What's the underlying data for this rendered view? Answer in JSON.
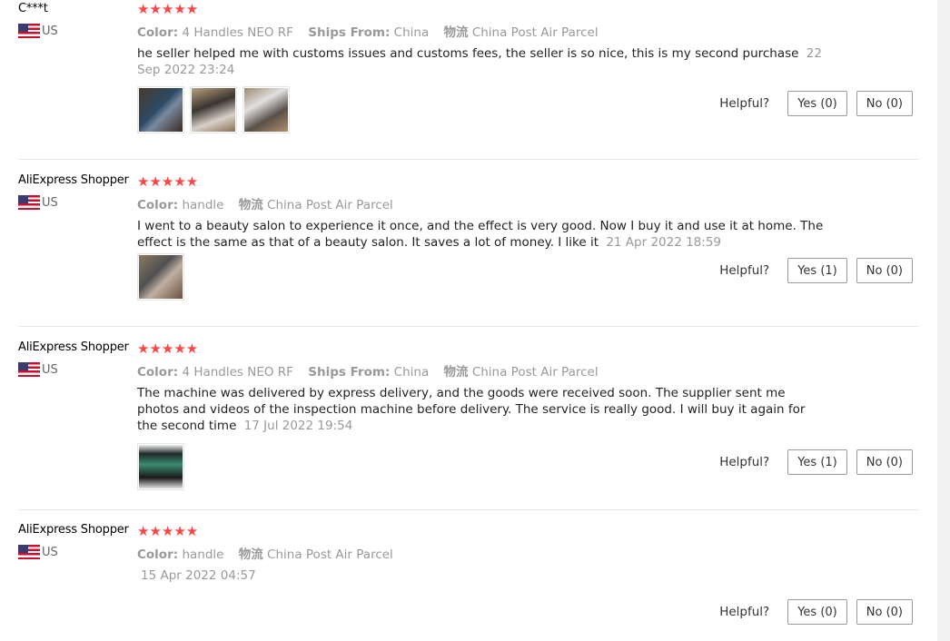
{
  "reviews": [
    {
      "user": "C***t",
      "country": "US",
      "rating": 5,
      "meta": [
        {
          "label": "Color:",
          "value": "4 Handles NEO RF"
        },
        {
          "label": "Ships From:",
          "value": "China"
        },
        {
          "label": "物流",
          "value": "China Post Air Parcel"
        }
      ],
      "text": "he seller helped me with customs issues and customs fees, the seller is so nice, this is my second purchase",
      "date": "22 Sep 2022 23:24",
      "photos": [
        "photo-1",
        "photo-2",
        "photo-3"
      ],
      "helpful_label": "Helpful?",
      "yes_label": "Yes (0)",
      "no_label": "No (0)"
    },
    {
      "user": "AliExpress Shopper",
      "country": "US",
      "rating": 5,
      "meta": [
        {
          "label": "Color:",
          "value": "handle"
        },
        {
          "label": "物流",
          "value": "China Post Air Parcel"
        }
      ],
      "text": "I went to a beauty salon to experience it once, and the effect is very good. Now I buy it and use it at home. The effect is the same as that of a beauty salon. It saves a lot of money. I like it",
      "date": "21 Apr 2022 18:59",
      "photos": [
        "photo-1"
      ],
      "helpful_label": "Helpful?",
      "yes_label": "Yes (1)",
      "no_label": "No (0)"
    },
    {
      "user": "AliExpress Shopper",
      "country": "US",
      "rating": 5,
      "meta": [
        {
          "label": "Color:",
          "value": "4 Handles NEO RF"
        },
        {
          "label": "Ships From:",
          "value": "China"
        },
        {
          "label": "物流",
          "value": "China Post Air Parcel"
        }
      ],
      "text": "The machine was delivered by express delivery, and the goods were received soon. The supplier sent me photos and videos of the inspection machine before delivery. The service is really good. I will buy it again for the second time",
      "date": "17 Jul 2022 19:54",
      "photos": [
        "photo-1"
      ],
      "helpful_label": "Helpful?",
      "yes_label": "Yes (1)",
      "no_label": "No (0)"
    },
    {
      "user": "AliExpress Shopper",
      "country": "US",
      "rating": 5,
      "meta": [
        {
          "label": "Color:",
          "value": "handle"
        },
        {
          "label": "物流",
          "value": "China Post Air Parcel"
        }
      ],
      "text": "",
      "date": "15 Apr 2022 04:57",
      "photos": [],
      "helpful_label": "Helpful?",
      "yes_label": "Yes (0)",
      "no_label": "No (0)"
    }
  ],
  "colors": {
    "star": "#ff4747",
    "meta": "#999999",
    "divider": "#e8e8e8"
  },
  "icons": {
    "star": "★",
    "flag": "us-flag-icon"
  }
}
